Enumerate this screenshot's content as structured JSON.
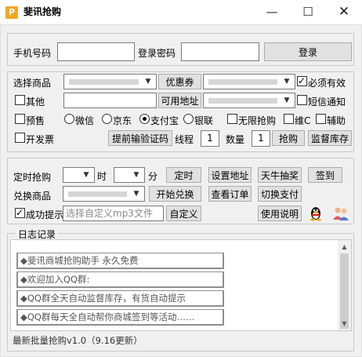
{
  "window": {
    "title": "斐讯抢购",
    "icon_letter": "P"
  },
  "controls": {
    "minimize": "—",
    "maximize": "☐",
    "close": "✕"
  },
  "login": {
    "phone_label": "手机号码",
    "password_label": "登录密码",
    "login_button": "登录"
  },
  "product": {
    "select_label": "选择商品",
    "coupon_button": "优惠券",
    "must_valid_label": "必须有效",
    "must_valid_checked": true,
    "other_label": "其他",
    "other_checked": false,
    "address_button": "可用地址",
    "sms_label": "短信通知",
    "sms_checked": false,
    "presale_label": "预售",
    "presale_checked": false,
    "pay_options": [
      {
        "label": "微信",
        "checked": false
      },
      {
        "label": "京东",
        "checked": false
      },
      {
        "label": "支付宝",
        "checked": true
      },
      {
        "label": "银联",
        "checked": false
      }
    ],
    "unlimited_label": "无限抢购",
    "unlimited_checked": false,
    "weic_label": "维C",
    "weic_checked": false,
    "assist_label": "辅助",
    "assist_checked": false,
    "invoice_label": "开发票",
    "invoice_checked": false,
    "captcha_button": "提前输验证码",
    "thread_label": "线程",
    "thread_value": "1",
    "quantity_label": "数量",
    "quantity_value": "1",
    "grab_button": "抢购",
    "monitor_button": "监督库存"
  },
  "schedule": {
    "timed_label": "定时抢购",
    "hour_label": "时",
    "minute_label": "分",
    "timer_button": "定时",
    "set_address_button": "设置地址",
    "lottery_button": "天牛抽奖",
    "signin_button": "签到",
    "exchange_label": "兑换商品",
    "start_exchange_button": "开始兑换",
    "view_orders_button": "查看订单",
    "switch_pay_button": "切换支付",
    "success_prompt_label": "成功提示",
    "success_prompt_checked": true,
    "mp3_placeholder": "选择自定义mp3文件",
    "custom_button": "自定义",
    "manual_button": "使用说明"
  },
  "log": {
    "legend": "日志记录",
    "lines": [
      "◆斐讯商城抢购助手        永久免费",
      "◆欢迎加入QQ群:",
      "◆QQ群全天自动监督库存，有货自动提示",
      "◆QQ群每天全自动帮你商城签到等活动……"
    ]
  },
  "version": "最新批量抢购v1.0（9.16更新）",
  "colors": {
    "window_bg": "#f0f0f0",
    "accent": "#0078d7",
    "icon": "#f5a623"
  }
}
